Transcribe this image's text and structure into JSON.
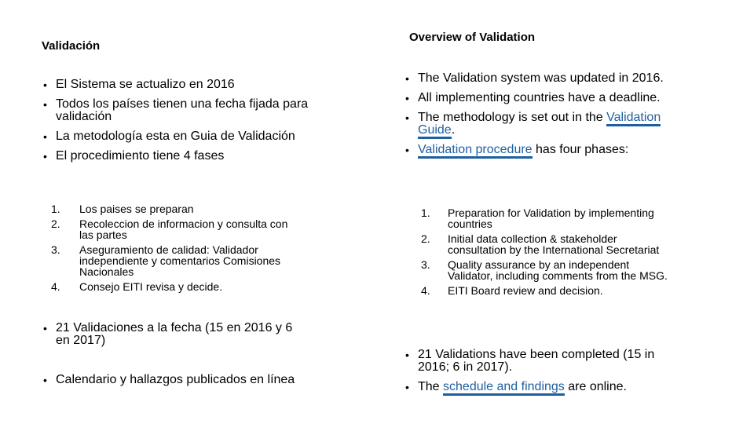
{
  "left": {
    "title": "Validación",
    "bullets": [
      "El Sistema se actualizo en 2016",
      "Todos los países tienen una fecha fijada para validación",
      "La metodología esta en Guia de Validación",
      "El procedimiento tiene 4 fases"
    ],
    "steps": [
      {
        "num": "1.",
        "text": "Los paises se preparan"
      },
      {
        "num": "2.",
        "text": "Recoleccion de informacion y consulta con las partes"
      },
      {
        "num": "3.",
        "text": "Aseguramiento de calidad: Validador independiente y comentarios Comisiones Nacionales"
      },
      {
        "num": "4.",
        "text": "Consejo EITI revisa y decide."
      }
    ],
    "bottom_bullets": [
      "21 Validaciones a la fecha (15 en 2016 y 6 en 2017)",
      "Calendario y hallazgos publicados en línea"
    ]
  },
  "right": {
    "title": "Overview of Validation",
    "bullets": {
      "b1": "The Validation system was updated in 2016.",
      "b2": "All implementing countries have a deadline.",
      "b3_pre": "The methodology is set out in the ",
      "b3_link": "Validation Guide",
      "b3_post": ".",
      "b4_link": "Validation procedure",
      "b4_post": " has four phases:"
    },
    "steps": [
      {
        "num": "1.",
        "text": "Preparation for Validation by implementing countries"
      },
      {
        "num": "2.",
        "text": "Initial data collection & stakeholder consultation by the International Secretariat"
      },
      {
        "num": "3.",
        "text": "Quality assurance by an independent Validator, including comments from the MSG."
      },
      {
        "num": "4.",
        "text": "EITI Board review and decision."
      }
    ],
    "bottom": {
      "b1": "21 Validations have been completed (15 in 2016; 6 in 2017).",
      "b2_pre": "The ",
      "b2_link": "schedule and findings",
      "b2_post": " are online."
    }
  },
  "colors": {
    "link": "#1f5fa0",
    "text": "#000000",
    "background": "#ffffff"
  }
}
